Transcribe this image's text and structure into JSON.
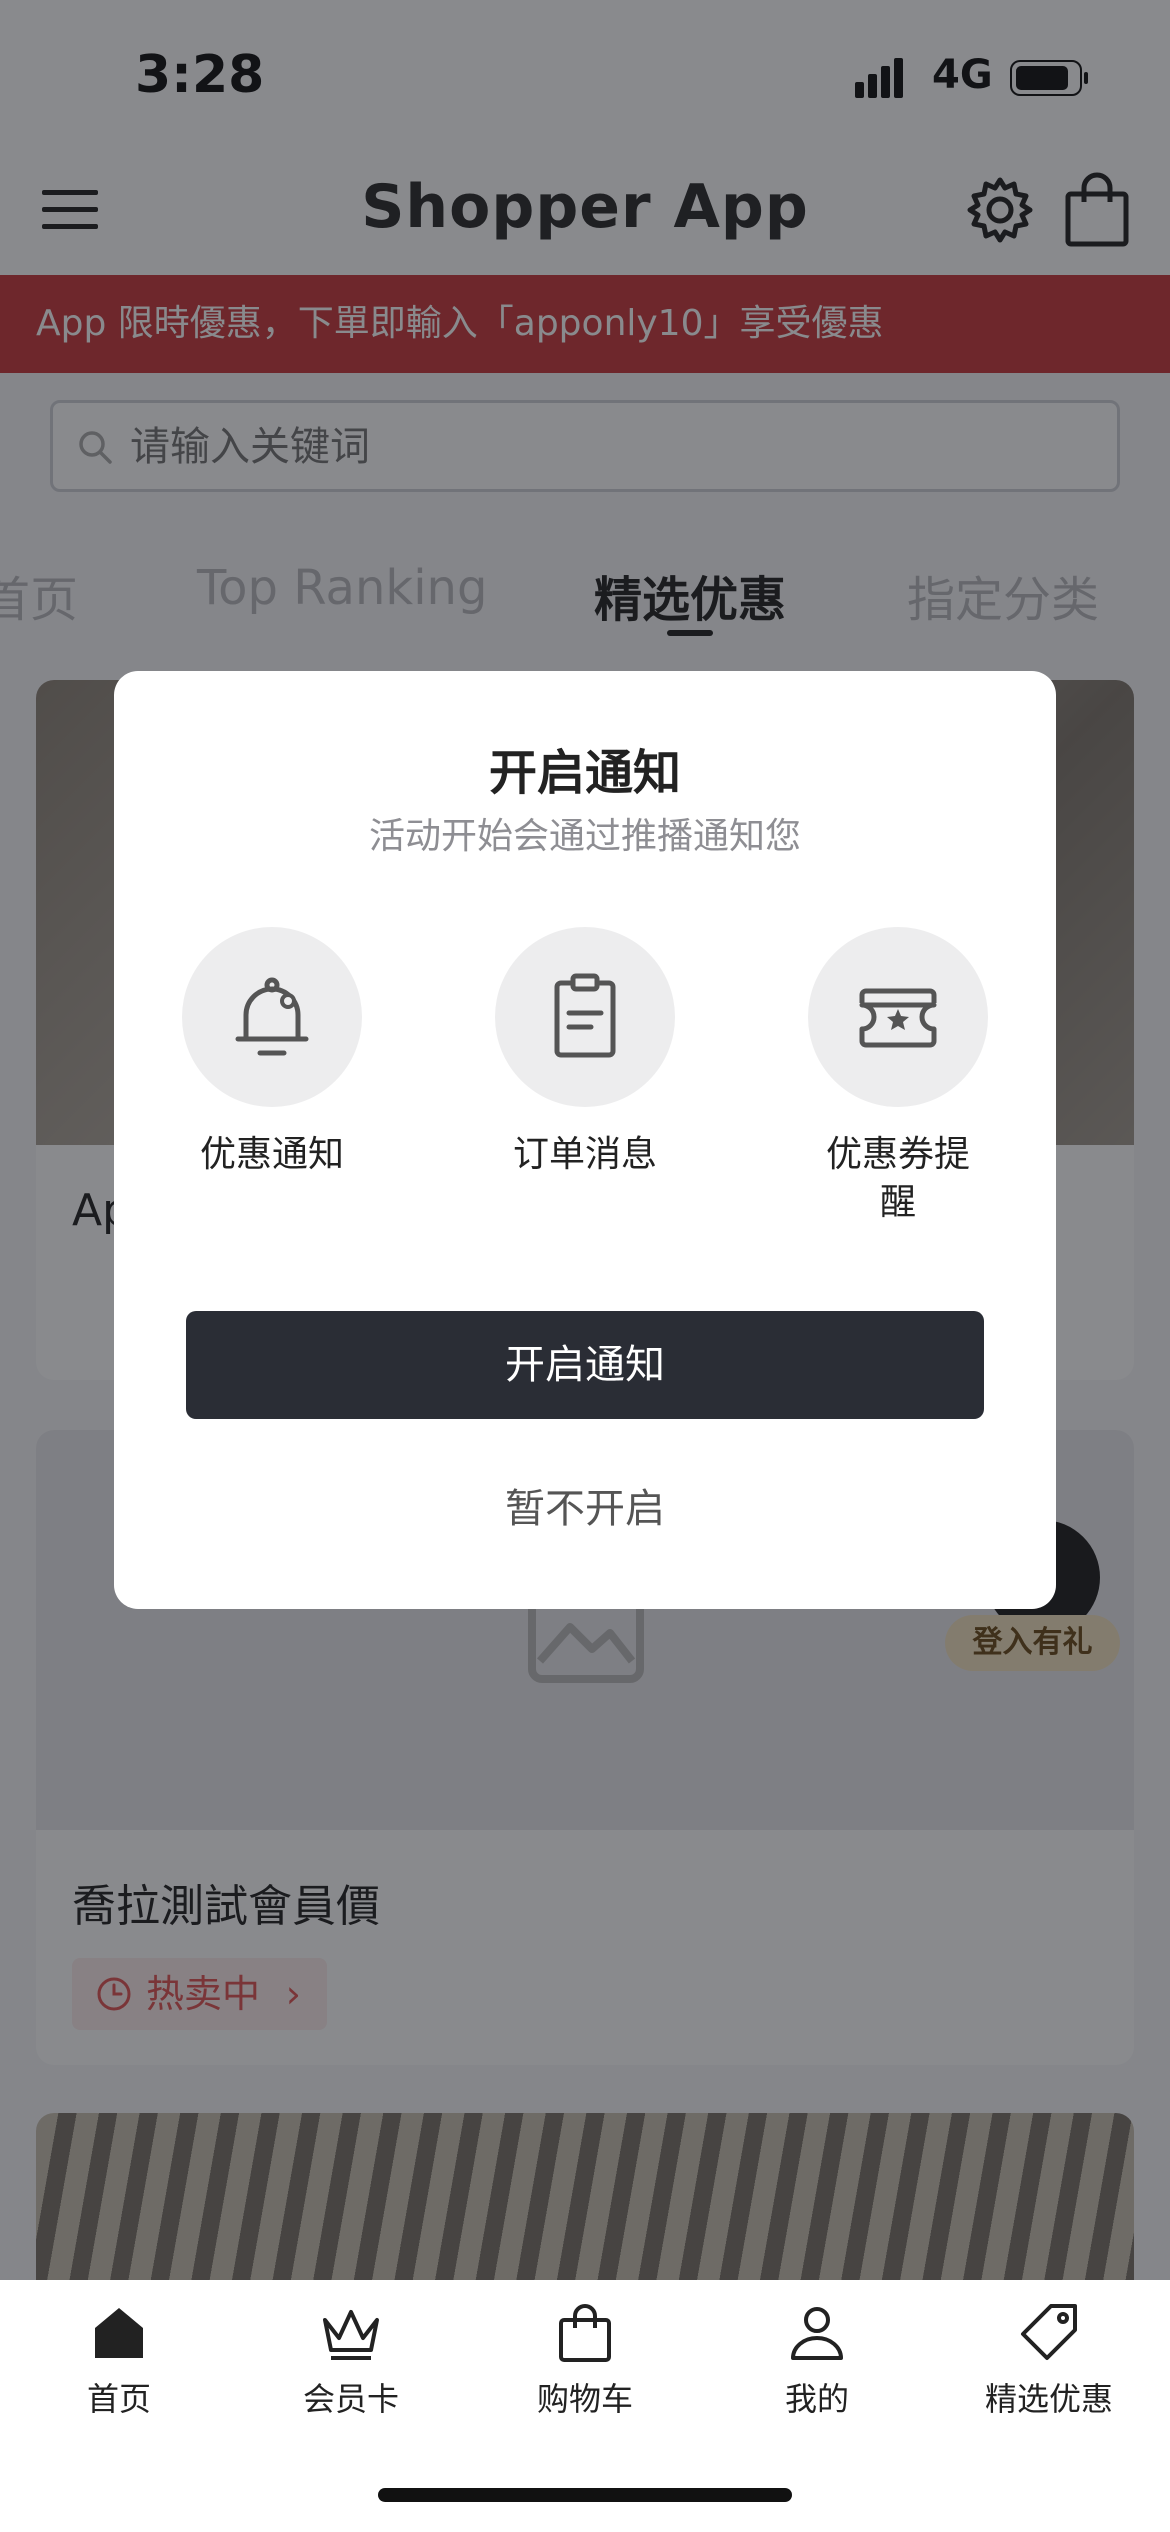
{
  "status_bar": {
    "time": "3:28",
    "network": "4G"
  },
  "header": {
    "title": "Shopper App"
  },
  "promo_banner": {
    "text": "App 限時優惠，下單即輸入「apponly10」享受優惠"
  },
  "search": {
    "placeholder": "请输入关键词"
  },
  "category_tabs": [
    {
      "label": "首页",
      "active": false
    },
    {
      "label": "Top Ranking",
      "active": false
    },
    {
      "label": "精选优惠",
      "active": true
    },
    {
      "label": "指定分类",
      "active": false
    }
  ],
  "products": [
    {
      "name": "Ap",
      "badge": ""
    },
    {
      "name": "喬拉測試會員價",
      "badge": "热卖中"
    }
  ],
  "login_badge": {
    "label": "登入有礼"
  },
  "modal": {
    "title": "开启通知",
    "subtitle": "活动开始会通过推播通知您",
    "options": [
      {
        "label": "优惠通知",
        "icon": "bell-icon"
      },
      {
        "label": "订单消息",
        "icon": "clipboard-icon"
      },
      {
        "label": "优惠券提醒",
        "icon": "coupon-icon"
      }
    ],
    "primary_button": "开启通知",
    "secondary_button": "暂不开启"
  },
  "bottom_nav": [
    {
      "label": "首页",
      "icon": "home-icon"
    },
    {
      "label": "会员卡",
      "icon": "crown-icon"
    },
    {
      "label": "购物车",
      "icon": "shopping-bag-icon"
    },
    {
      "label": "我的",
      "icon": "person-icon"
    },
    {
      "label": "精选优惠",
      "icon": "tag-icon"
    }
  ],
  "colors": {
    "promo": "#c8383c",
    "primary_button": "#2a2d35",
    "hot_badge": "#e05555"
  }
}
